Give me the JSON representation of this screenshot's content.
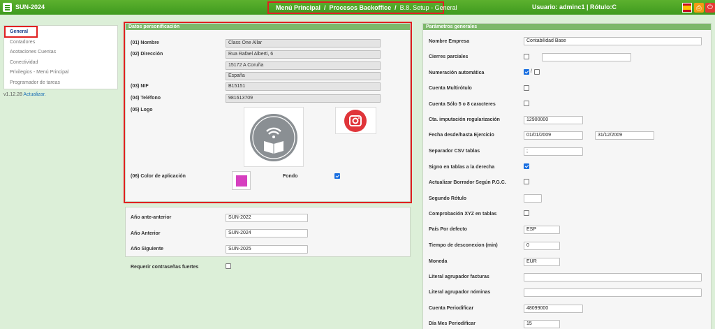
{
  "app": {
    "title": "SUN-2024"
  },
  "breadcrumb": {
    "menu": "Menú Principal",
    "backoffice": "Procesos Backoffice",
    "current": "B.8. Setup - General"
  },
  "user": {
    "info": "Usuario: adminc1 | Rótulo:C"
  },
  "icons": {
    "flag": "spain-flag-icon",
    "print": "printer-icon",
    "power": "power-icon",
    "menu": "hamburger-menu-icon"
  },
  "sidebar": {
    "items": [
      {
        "label": "General",
        "active": true
      },
      {
        "label": "Contadores"
      },
      {
        "label": "Acotaciones Cuentas"
      },
      {
        "label": "Conectividad"
      },
      {
        "label": "Privilegios - Menú Principal"
      },
      {
        "label": "Programador de tareas"
      }
    ],
    "version": "v1.12.28",
    "update_link": "Actualizar."
  },
  "personalizacion": {
    "header": "Datos personificación",
    "nombre_label": "(01) Nombre",
    "nombre": "Class One Allar",
    "direccion_label": "(02) Dirección",
    "direccion1": "Rua Rafael Alberti, 6",
    "direccion2": "15172 A Coruña",
    "direccion3": "España",
    "nif_label": "(03) NIF",
    "nif": "B15151",
    "telefono_label": "(04) Teléfono",
    "telefono": "981613709",
    "logo_label": "(05) Logo",
    "color_label": "(06) Color de aplicación",
    "color_value": "#d63fbf",
    "fondo_label": "Fondo",
    "fondo_checked": true
  },
  "years": {
    "ante_anterior_label": "Año ante-anterior",
    "ante_anterior": "SUN-2022",
    "anterior_label": "Año Anterior",
    "anterior": "SUN-2024",
    "siguiente_label": "Año Siguiente",
    "siguiente": "SUN-2025"
  },
  "security": {
    "strong_pw_label": "Requerir contraseñas fuertes",
    "strong_pw_checked": false
  },
  "params": {
    "header": "Parámetros generales",
    "nombre_empresa_label": "Nombre Empresa",
    "nombre_empresa": "Contabilidad Base",
    "cierres_label": "Cierres parciales",
    "cierres_text": "",
    "numeracion_label": "Numeración automática",
    "multirotulo_label": "Cuenta Multirótulo",
    "cuenta58_label": "Cuenta Sólo 5 o 8 caracteres",
    "cta_imputacion_label": "Cta. imputación regularización",
    "cta_imputacion": "12900000",
    "fecha_label": "Fecha desde/hasta Ejercicio",
    "fecha_desde": "01/01/2009",
    "fecha_hasta": "31/12/2009",
    "separador_label": "Separador CSV tablas",
    "separador": ";",
    "signo_label": "Signo en tablas a la derecha",
    "borrador_label": "Actualizar Borrador Según P.G.C.",
    "segundo_rotulo_label": "Segundo Rótulo",
    "segundo_rotulo": "",
    "xyz_label": "Comprobación XYZ en tablas",
    "pais_label": "País Por defecto",
    "pais": "ESP",
    "tiempo_label": "Tiempo de desconexion (min)",
    "tiempo": "0",
    "moneda_label": "Moneda",
    "moneda": "EUR",
    "lit_facturas_label": "Literal agrupador facturas",
    "lit_facturas": "",
    "lit_nominas_label": "Literal agrupador nóminas",
    "lit_nominas": "",
    "cuenta_periodificar_label": "Cuenta Periodificar",
    "cuenta_periodificar": "48099000",
    "dia_mes_label": "Día Mes Periodificar",
    "dia_mes": "15"
  }
}
